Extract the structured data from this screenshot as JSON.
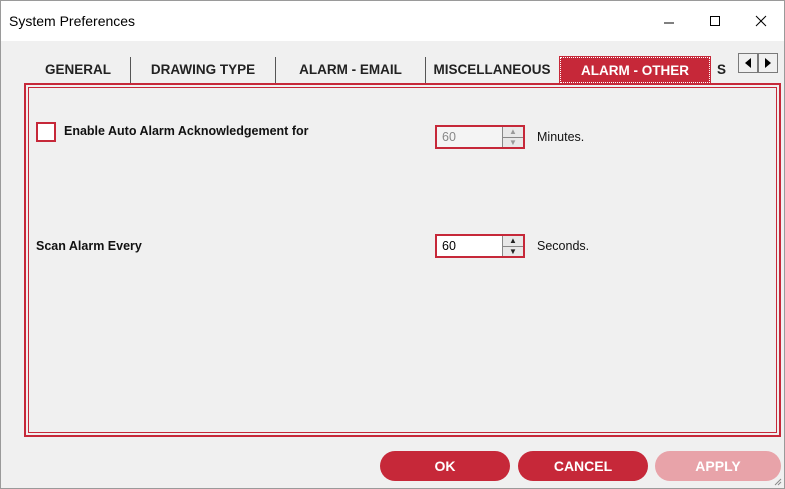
{
  "window": {
    "title": "System Preferences"
  },
  "tabs": [
    {
      "label": "GENERAL",
      "active": false
    },
    {
      "label": "DRAWING TYPE",
      "active": false
    },
    {
      "label": "ALARM - EMAIL",
      "active": false
    },
    {
      "label": "MISCELLANEOUS",
      "active": false
    },
    {
      "label": "ALARM - OTHER",
      "active": true
    },
    {
      "label": "S",
      "active": false
    }
  ],
  "settings": {
    "auto_ack": {
      "label": "Enable Auto Alarm Acknowledgement for",
      "checked": false,
      "value": "60",
      "unit": "Minutes.",
      "enabled": false
    },
    "scan": {
      "label": "Scan Alarm Every",
      "value": "60",
      "unit": "Seconds."
    }
  },
  "buttons": {
    "ok": "OK",
    "cancel": "CANCEL",
    "apply": "APPLY"
  },
  "colors": {
    "accent": "#c62839",
    "accent_disabled": "#e8a3a9",
    "background": "#f0f0f0"
  }
}
